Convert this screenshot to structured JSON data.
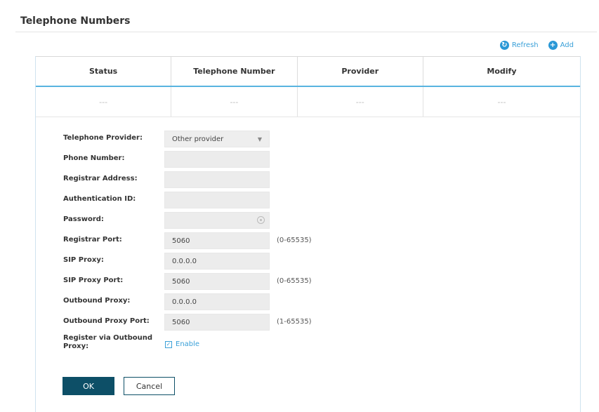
{
  "page": {
    "title": "Telephone Numbers"
  },
  "toolbar": {
    "refresh_label": "Refresh",
    "add_label": "Add"
  },
  "table": {
    "headers": [
      "Status",
      "Telephone Number",
      "Provider",
      "Modify"
    ],
    "rows": [
      [
        "---",
        "---",
        "---",
        "---"
      ]
    ]
  },
  "form": {
    "telephone_provider": {
      "label": "Telephone Provider:",
      "value": "Other provider"
    },
    "phone_number": {
      "label": "Phone Number:",
      "value": ""
    },
    "registrar_address": {
      "label": "Registrar Address:",
      "value": ""
    },
    "authentication_id": {
      "label": "Authentication ID:",
      "value": ""
    },
    "password": {
      "label": "Password:",
      "value": ""
    },
    "registrar_port": {
      "label": "Registrar Port:",
      "value": "5060",
      "hint": "(0-65535)"
    },
    "sip_proxy": {
      "label": "SIP Proxy:",
      "value": "0.0.0.0"
    },
    "sip_proxy_port": {
      "label": "SIP Proxy Port:",
      "value": "5060",
      "hint": "(0-65535)"
    },
    "outbound_proxy": {
      "label": "Outbound Proxy:",
      "value": "0.0.0.0"
    },
    "outbound_proxy_port": {
      "label": "Outbound Proxy Port:",
      "value": "5060",
      "hint": "(1-65535)"
    },
    "register_via_outbound": {
      "label": "Register via Outbound Proxy:",
      "checkbox_label": "Enable",
      "checked": true
    }
  },
  "buttons": {
    "ok_label": "OK",
    "cancel_label": "Cancel"
  },
  "colors": {
    "accent": "#2a98d6",
    "primary_button": "#0d4f67",
    "header_rule": "#58b4e0"
  }
}
